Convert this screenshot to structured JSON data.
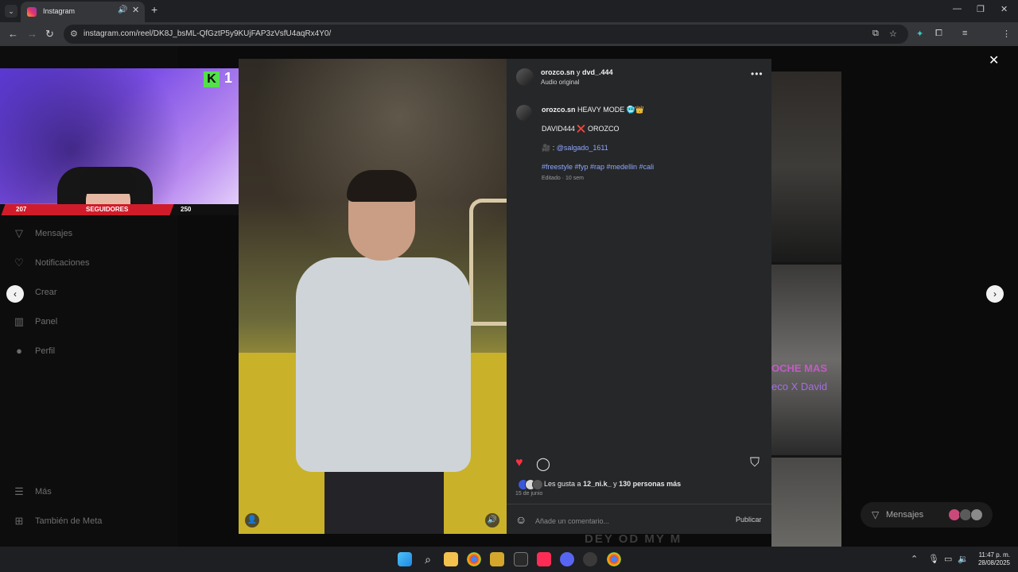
{
  "browser": {
    "tab_title": "Instagram",
    "tab_dropdown_icon": "⌄",
    "new_tab": "+",
    "url": "instagram.com/reel/DK8J_bsML-QfGztP5y9KUjFAP3zVsfU4aqRx4Y0/",
    "window_controls": [
      "—",
      "❐",
      "✕"
    ]
  },
  "sidebar": {
    "items": [
      {
        "label": "Mensajes",
        "icon": "▽"
      },
      {
        "label": "Notificaciones",
        "icon": "♡"
      },
      {
        "label": "Crear",
        "icon": "+"
      },
      {
        "label": "Panel",
        "icon": "▥"
      },
      {
        "label": "Perfil",
        "icon": "●"
      },
      {
        "label": "Más",
        "icon": "☰"
      },
      {
        "label": "También de Meta",
        "icon": "⊞"
      }
    ]
  },
  "webcam": {
    "badge_letter": "K",
    "badge_number": "1",
    "followers_current": "207",
    "followers_label": "SEGUIDORES",
    "followers_goal": "250"
  },
  "post": {
    "author": "orozco.sn",
    "joiner": "y",
    "coauthor": "dvd_.444",
    "audio": "Audio original",
    "more_icon": "•••",
    "caption": {
      "line1_user": "orozco.sn",
      "line1_text": "HEAVY MODE 🥶👑",
      "line2": "DAVID444 ❌ OROZCO",
      "line3_prefix": "🎥 :",
      "line3_mention": "@salgado_1611",
      "hashtags": "#freestyle #fyp #rap #medellin #cali",
      "edited": "Editado · 10 sem"
    },
    "likes_prefix": "Les gusta a",
    "likes_user": "12_ni.k_",
    "likes_middle": "y",
    "likes_count": "130 personas más",
    "date": "15 de junio",
    "comment_placeholder": "Añade un comentario...",
    "publish_label": "Publicar"
  },
  "grid": {
    "overlay_text_1": "OCHE MAS",
    "overlay_text_2": "eco X David"
  },
  "floating_messages": {
    "label": "Mensajes"
  },
  "bottom_art_text": "DEY OD MY M",
  "clock": {
    "time": "11:47 p. m.",
    "date": "28/08/2025"
  },
  "colors": {
    "like": "#ff3040",
    "mention": "#8fa7ff",
    "panel_bg": "#252729",
    "follow_bar": "#d01c2a"
  }
}
